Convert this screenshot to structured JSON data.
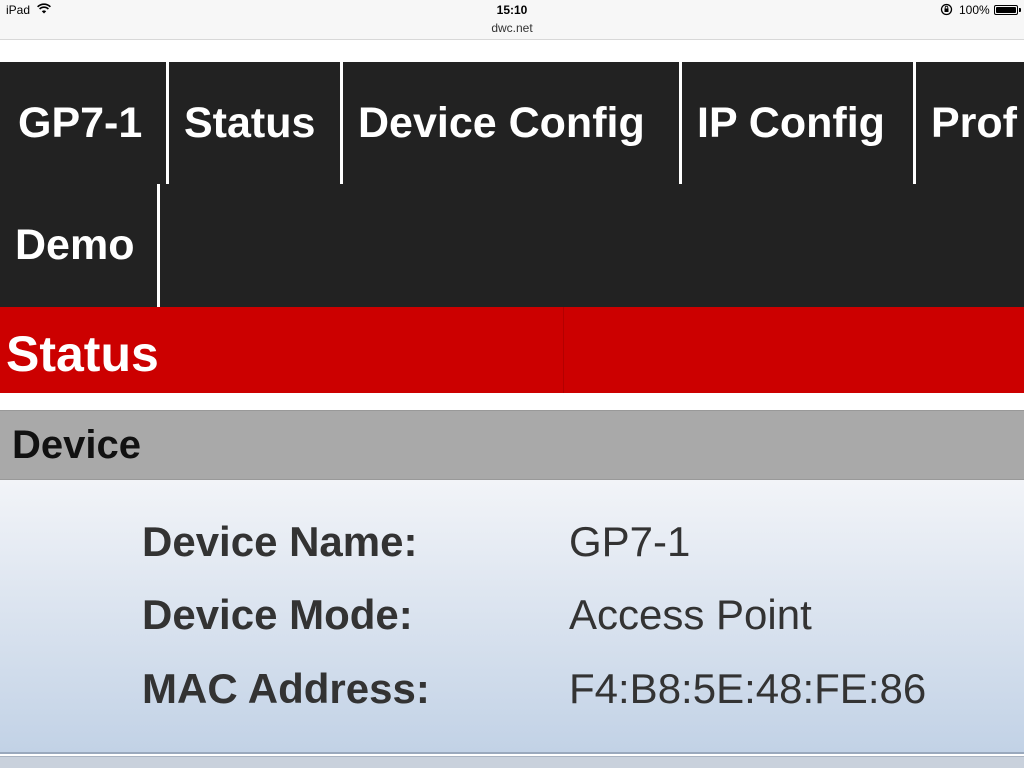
{
  "os_status": {
    "device": "iPad",
    "time": "15:10",
    "battery": "100%"
  },
  "browser": {
    "url": "dwc.net"
  },
  "nav": {
    "tabs": [
      "GP7-1",
      "Status",
      "Device Config",
      "IP Config",
      "Prof",
      "Demo"
    ]
  },
  "page": {
    "title": "Status"
  },
  "section": {
    "title": "Device",
    "fields": [
      {
        "label": "Device Name:",
        "value": "GP7-1"
      },
      {
        "label": "Device Mode:",
        "value": "Access Point"
      },
      {
        "label": "MAC Address:",
        "value": "F4:B8:5E:48:FE:86"
      }
    ]
  },
  "colors": {
    "nav_bg": "#222222",
    "header_red": "#cc0000",
    "section_gray": "#a9a9a9"
  }
}
